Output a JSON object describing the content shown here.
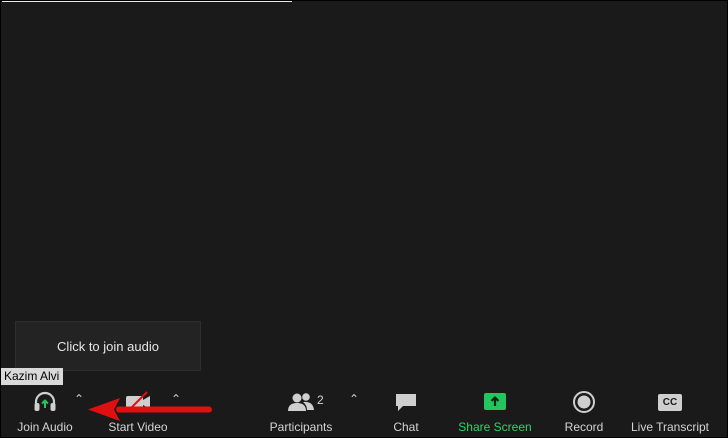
{
  "tooltip": {
    "text": "Click to join audio"
  },
  "participant": {
    "name": "Kazim Alvi"
  },
  "toolbar": {
    "join_audio": {
      "label": "Join Audio",
      "icon": "headphones-icon"
    },
    "start_video": {
      "label": "Start Video",
      "icon": "video-off-icon"
    },
    "participants": {
      "label": "Participants",
      "count": "2",
      "icon": "participants-icon"
    },
    "chat": {
      "label": "Chat",
      "icon": "chat-icon"
    },
    "share_screen": {
      "label": "Share Screen",
      "icon": "share-screen-icon"
    },
    "record": {
      "label": "Record",
      "icon": "record-icon"
    },
    "live_transcript": {
      "label": "Live Transcript",
      "icon_text": "CC",
      "icon": "cc-icon"
    }
  },
  "colors": {
    "background": "#1a1a1a",
    "accent_green": "#22c55e",
    "annotation_arrow": "#e01010"
  }
}
